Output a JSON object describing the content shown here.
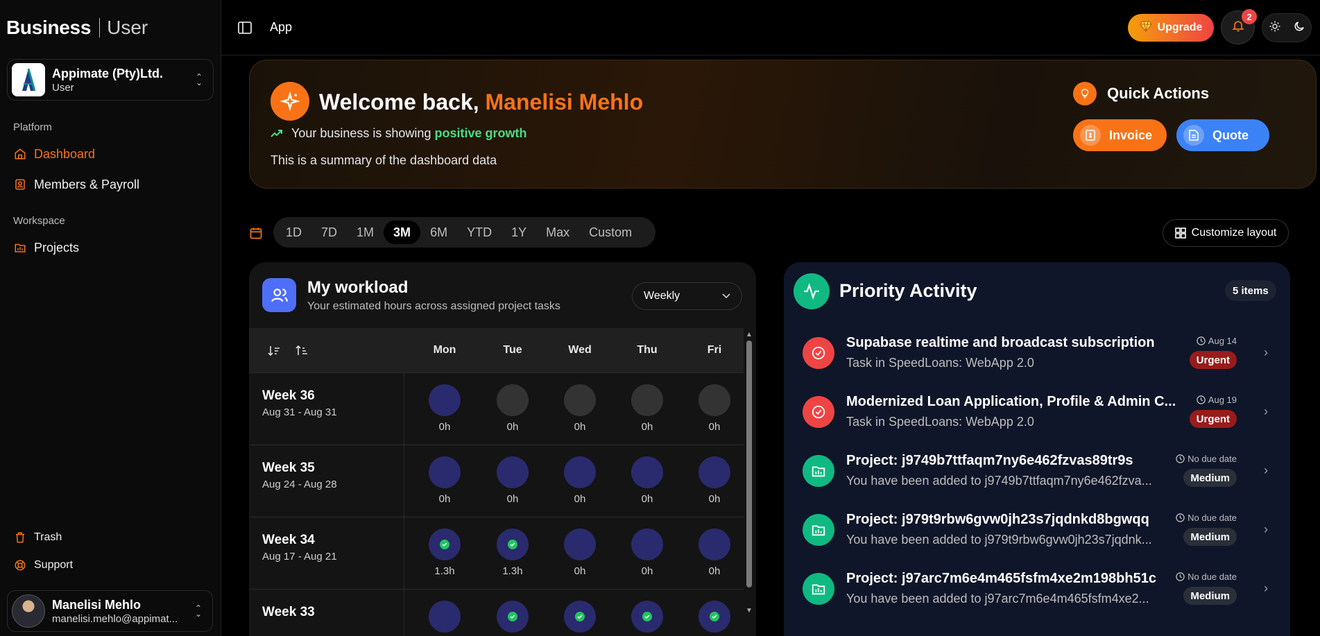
{
  "sidebar": {
    "brand_primary": "Business",
    "brand_secondary": "User",
    "org": {
      "name": "Appimate (Pty)Ltd.",
      "role": "User"
    },
    "platform_label": "Platform",
    "platform_items": [
      {
        "label": "Dashboard",
        "icon": "home-icon",
        "active": true
      },
      {
        "label": "Members & Payroll",
        "icon": "id-badge-icon",
        "active": false
      }
    ],
    "workspace_label": "Workspace",
    "workspace_items": [
      {
        "label": "Projects",
        "icon": "folder-chart-icon"
      }
    ],
    "bottom_items": [
      {
        "label": "Trash",
        "icon": "trash-icon"
      },
      {
        "label": "Support",
        "icon": "lifebuoy-icon"
      }
    ],
    "user": {
      "name": "Manelisi Mehlo",
      "email": "manelisi.mehlo@appimat..."
    }
  },
  "topbar": {
    "breadcrumb": "App",
    "upgrade_label": "Upgrade",
    "notification_count": "2"
  },
  "welcome": {
    "greeting": "Welcome back, ",
    "name": "Manelisi Mehlo",
    "growth_prefix": "Your business is showing",
    "growth_highlight": "positive growth",
    "summary": "This is a summary of the dashboard data",
    "quick_actions_title": "Quick Actions",
    "invoice_label": "Invoice",
    "quote_label": "Quote"
  },
  "range": {
    "options": [
      "1D",
      "7D",
      "1M",
      "3M",
      "6M",
      "YTD",
      "1Y",
      "Max",
      "Custom"
    ],
    "selected": "3M",
    "customize_label": "Customize layout"
  },
  "workload": {
    "title": "My workload",
    "subtitle": "Your estimated hours across assigned project tasks",
    "view_selected": "Weekly",
    "days": [
      "Mon",
      "Tue",
      "Wed",
      "Thu",
      "Fri"
    ],
    "weeks": [
      {
        "label": "Week 36",
        "range": "Aug 31 - Aug 31",
        "hours": [
          "0h",
          "0h",
          "0h",
          "0h",
          "0h"
        ]
      },
      {
        "label": "Week 35",
        "range": "Aug 24 - Aug 28",
        "hours": [
          "0h",
          "0h",
          "0h",
          "0h",
          "0h"
        ]
      },
      {
        "label": "Week 34",
        "range": "Aug 17 - Aug 21",
        "hours": [
          "1.3h",
          "1.3h",
          "0h",
          "0h",
          "0h"
        ]
      },
      {
        "label": "Week 33",
        "range": "",
        "hours": [
          "",
          "",
          "",
          "",
          ""
        ]
      }
    ]
  },
  "priority": {
    "title": "Priority Activity",
    "count_label": "5 items",
    "items": [
      {
        "title": "Supabase realtime and broadcast subscription",
        "subtitle": "Task in SpeedLoans: WebApp 2.0",
        "due": "Aug 14",
        "priority": "Urgent",
        "kind": "task"
      },
      {
        "title": "Modernized Loan Application, Profile & Admin C...",
        "subtitle": "Task in SpeedLoans: WebApp 2.0",
        "due": "Aug 19",
        "priority": "Urgent",
        "kind": "task"
      },
      {
        "title": "Project: j9749b7ttfaqm7ny6e462fzvas89tr9s",
        "subtitle": "You have been added to j9749b7ttfaqm7ny6e462fzva...",
        "due": "No due date",
        "priority": "Medium",
        "kind": "project"
      },
      {
        "title": "Project: j979t9rbw6gvw0jh23s7jqdnkd8bgwqq",
        "subtitle": "You have been added to j979t9rbw6gvw0jh23s7jqdnk...",
        "due": "No due date",
        "priority": "Medium",
        "kind": "project"
      },
      {
        "title": "Project: j97arc7m6e4m465fsfm4xe2m198bh51c",
        "subtitle": "You have been added to j97arc7m6e4m465fsfm4xe2...",
        "due": "No due date",
        "priority": "Medium",
        "kind": "project"
      }
    ]
  },
  "colors": {
    "accent": "#f97316",
    "blue": "#3b82f6",
    "green": "#10b981",
    "urgent": "#991b1b"
  }
}
